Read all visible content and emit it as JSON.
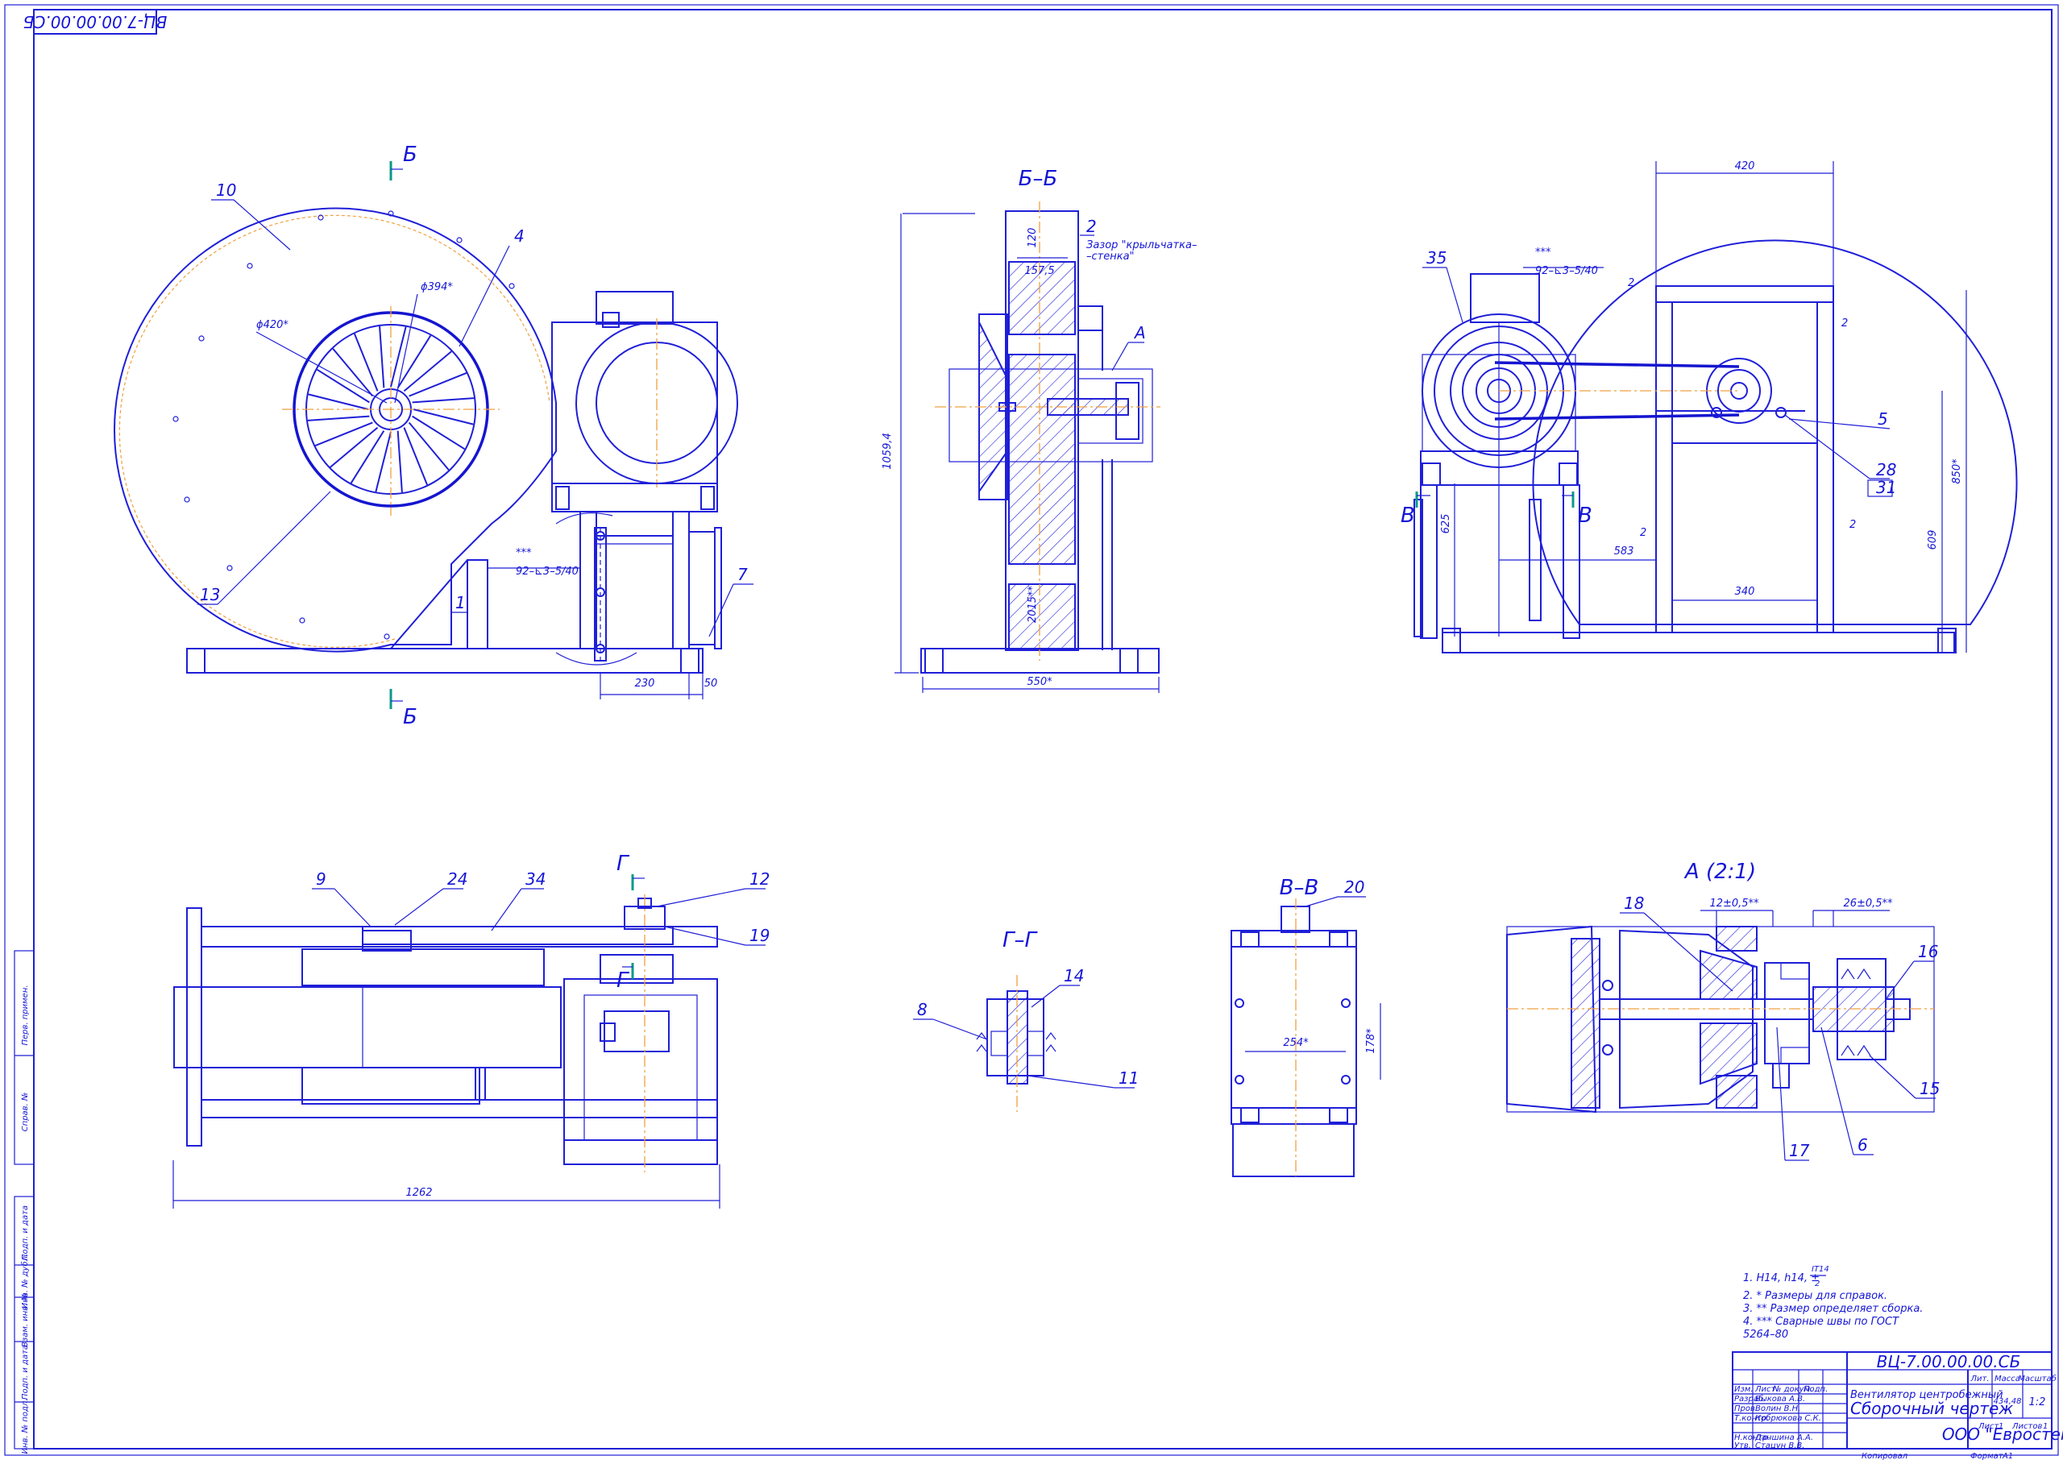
{
  "colors": {
    "line": "#1f1fd8",
    "axis": "#f0a040",
    "section_marker": "#0a9a8a",
    "paper": "#ffffff"
  },
  "sheet": {
    "mirrored_code": "ВЦ-7.00.00.00.СБ"
  },
  "views": {
    "section_bb": "Б–Б",
    "section_gg": "Г–Г",
    "section_vv": "В–В",
    "detail_a": "А (2:1)",
    "cut_b": "Б",
    "cut_v": "В",
    "cut_g": "Г",
    "mark_a": "А"
  },
  "front_view": {
    "callouts": [
      "10",
      "4",
      "13",
      "7",
      "1"
    ],
    "dims": {
      "d420": "ϕ420*",
      "d394": "ϕ394*",
      "w230": "230",
      "w50": "50"
    },
    "weld": {
      "stars": "***",
      "spec": "92–⊾3–5/40"
    }
  },
  "section_bb_view": {
    "callouts": [
      "2"
    ],
    "note_line1": "Зазор \"крыльчатка–",
    "note_line2": "–стенка\"",
    "dims": {
      "h1059": "1059,4",
      "w157": "157,5",
      "h120": "120",
      "h2015": "2015**",
      "w550": "550*"
    }
  },
  "side_view": {
    "callouts": [
      "35",
      "5",
      "28",
      "31"
    ],
    "dims": {
      "w420": "420",
      "w583": "583",
      "w340": "340",
      "h850": "850*",
      "h609": "609",
      "h625": "625"
    },
    "weld": {
      "stars": "***",
      "spec": "92–⊾3–5/40"
    },
    "weld_marks": [
      "2",
      "2",
      "2",
      "2"
    ]
  },
  "top_view": {
    "callouts": [
      "9",
      "24",
      "34",
      "12",
      "19"
    ],
    "dims": {
      "w1262": "1262"
    }
  },
  "gg_view": {
    "callouts": [
      "8",
      "14",
      "11"
    ]
  },
  "vv_view": {
    "callouts": [
      "20"
    ],
    "dims": {
      "w254": "254*",
      "h178": "178*"
    }
  },
  "detail_view": {
    "callouts": [
      "18",
      "16",
      "15",
      "17",
      "6"
    ],
    "dims": {
      "d12": "12±0,5**",
      "d26": "26±0,5**"
    }
  },
  "notes": [
    "1. H14, h14, ±",
    "2. * Размеры для справок.",
    "3. ** Размер определяет сборка.",
    "4. *** Сварные швы по ГОСТ",
    "5264–80"
  ],
  "note_fraction": {
    "num": "IT14",
    "den": "2"
  },
  "title_block": {
    "code": "ВЦ-7.00.00.00.СБ",
    "name_line1": "Вентилятор центробежный",
    "name_line2": "Сборочный чертеж",
    "org": "ООО \"Евростек\"",
    "headers": {
      "lit": "Лит.",
      "mass": "Масса",
      "scale": "Масштаб",
      "sheet": "Лист",
      "sheets": "Листов"
    },
    "mass": "434,48",
    "scale": "1:2",
    "sheet_no": "1",
    "sheets_no": "1",
    "rows": [
      {
        "role": "Изм.",
        "name": "Лист",
        "sign": "№ докум.",
        "date": "Подп."
      },
      {
        "role": "Разраб.",
        "name": "Быкова А.В.",
        "sign": "",
        "date": ""
      },
      {
        "role": "Пров.",
        "name": "Волин В.Н.",
        "sign": "",
        "date": ""
      },
      {
        "role": "Т.контр.",
        "name": "Кобрюкова С.К.",
        "sign": "",
        "date": ""
      },
      {
        "role": "Н.контр.",
        "name": "Даншина А.А.",
        "sign": "",
        "date": ""
      },
      {
        "role": "Утв.",
        "name": "Стацун В.В.",
        "sign": "",
        "date": ""
      }
    ],
    "copied": "Копировал",
    "format": "Формат",
    "format_val": "A1"
  },
  "margin_stamps": [
    "Перв. примен.",
    "Справ. №",
    "Подп. и дата",
    "Инв. № дубл.",
    "Взам. инв. №",
    "Подп. и дата",
    "Инв. № подл."
  ]
}
